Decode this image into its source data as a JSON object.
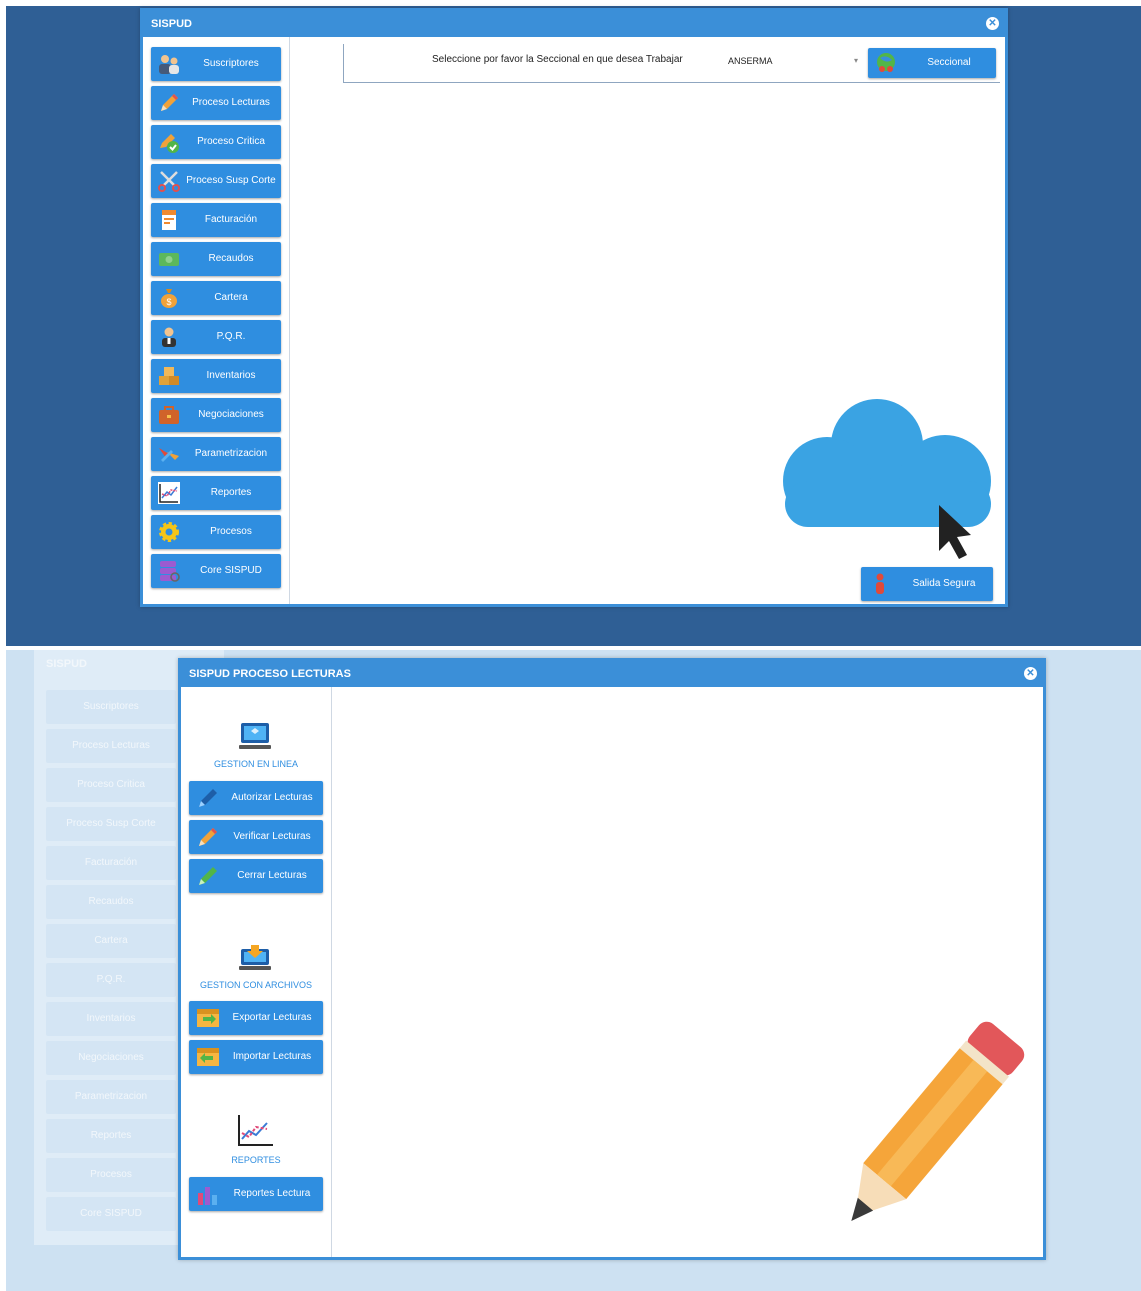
{
  "top_window": {
    "title": "SISPUD",
    "close_icon": "x",
    "menu": [
      {
        "label": "Suscriptores",
        "icon": "users-icon"
      },
      {
        "label": "Proceso Lecturas",
        "icon": "pencil-icon"
      },
      {
        "label": "Proceso Critica",
        "icon": "pencil-check-icon"
      },
      {
        "label": "Proceso Susp Corte",
        "icon": "scissors-icon"
      },
      {
        "label": "Facturación",
        "icon": "invoice-icon"
      },
      {
        "label": "Recaudos",
        "icon": "cash-icon"
      },
      {
        "label": "Cartera",
        "icon": "money-bag-icon"
      },
      {
        "label": "P.Q.R.",
        "icon": "person-icon"
      },
      {
        "label": "Inventarios",
        "icon": "boxes-icon"
      },
      {
        "label": "Negociaciones",
        "icon": "briefcase-icon"
      },
      {
        "label": "Parametrizacion",
        "icon": "tools-icon"
      },
      {
        "label": "Reportes",
        "icon": "chart-icon"
      },
      {
        "label": "Procesos",
        "icon": "gear-icon"
      },
      {
        "label": "Core SISPUD",
        "icon": "database-icon"
      }
    ],
    "prompt": "Seleccione por favor la Seccional en que desea Trabajar",
    "seccional_select": {
      "value": "ANSERMA"
    },
    "seccional_button": "Seccional",
    "exit_button": "Salida Segura"
  },
  "bottom_window": {
    "ghost_title": "SISPUD",
    "title": "SISPUD PROCESO LECTURAS",
    "sections": [
      {
        "label": "GESTION EN LINEA",
        "buttons": [
          "Autorizar Lecturas",
          "Verificar Lecturas",
          "Cerrar Lecturas"
        ]
      },
      {
        "label": "GESTION CON ARCHIVOS",
        "buttons": [
          "Exportar Lecturas",
          "Importar Lecturas"
        ]
      },
      {
        "label": "REPORTES",
        "buttons": [
          "Reportes Lectura"
        ]
      }
    ]
  },
  "colors": {
    "accent": "#2f8ee0",
    "title_bar": "#3b8fd8",
    "desktop_top": "#2f5f95",
    "desktop_bottom": "#cde1f2",
    "cloud": "#3aa3e3"
  }
}
